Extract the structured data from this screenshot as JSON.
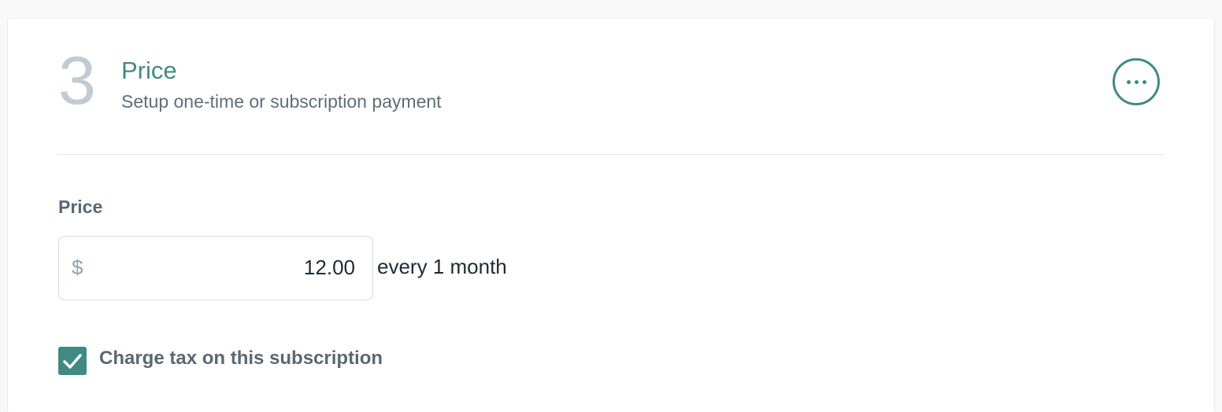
{
  "section": {
    "step_number": "3",
    "title": "Price",
    "subtitle": "Setup one-time or subscription payment"
  },
  "more_menu": {
    "icon": "more-horizontal-icon"
  },
  "price_field": {
    "label": "Price",
    "currency_symbol": "$",
    "value": "12.00",
    "interval_text": "every 1 month"
  },
  "tax": {
    "checked": true,
    "label": "Charge tax on this subscription"
  },
  "colors": {
    "accent": "#3f8b82",
    "step_number": "#c3cbd2",
    "label_text": "#5a6873",
    "body_text": "#1f2a33"
  }
}
